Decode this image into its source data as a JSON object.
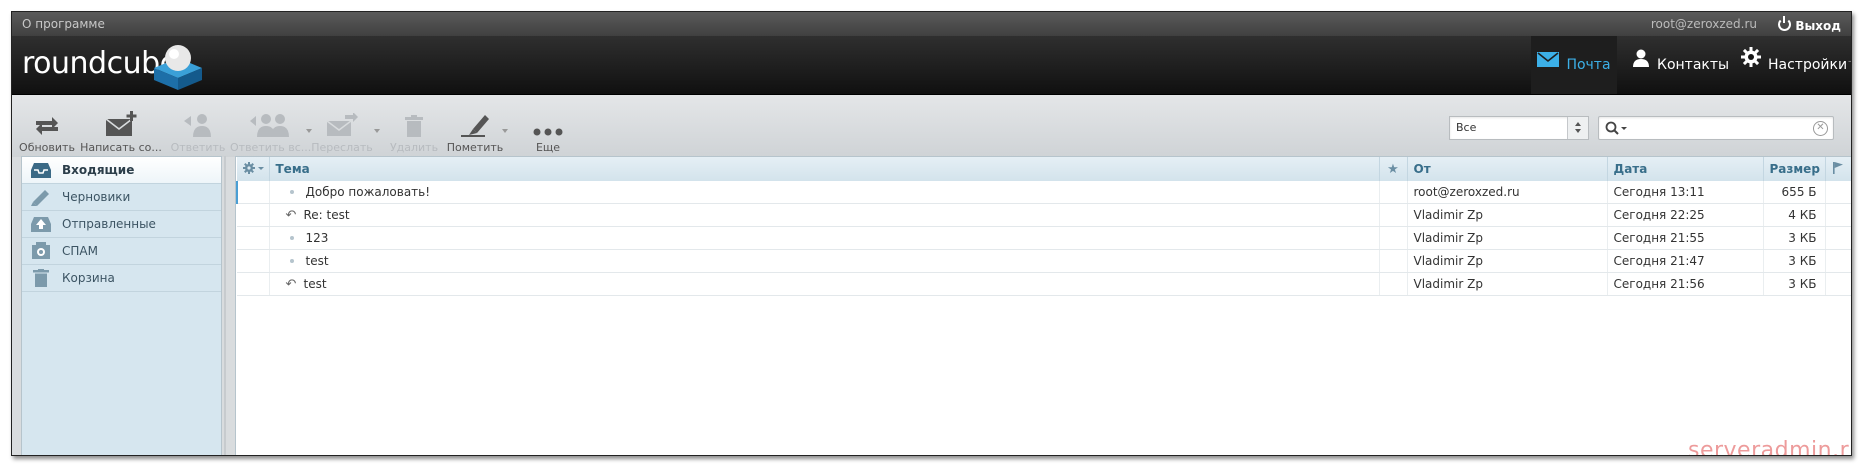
{
  "topbar": {
    "about": "О программе",
    "user": "root@zeroxzed.ru",
    "logout": "Выход"
  },
  "logo": "roundcube",
  "nav": {
    "mail": "Почта",
    "contacts": "Контакты",
    "settings": "Настройки"
  },
  "toolbar": {
    "refresh": "Обновить",
    "compose": "Написать со...",
    "reply": "Ответить",
    "reply_all": "Ответить вс...",
    "forward": "Переслать",
    "delete": "Удалить",
    "mark": "Пометить",
    "more": "Еще"
  },
  "filter": {
    "value": "Все"
  },
  "search": {
    "value": ""
  },
  "folders": [
    {
      "name": "Входящие",
      "icon": "inbox-icon"
    },
    {
      "name": "Черновики",
      "icon": "pencil-icon"
    },
    {
      "name": "Отправленные",
      "icon": "sent-icon"
    },
    {
      "name": "СПАМ",
      "icon": "spam-icon"
    },
    {
      "name": "Корзина",
      "icon": "trash-icon"
    }
  ],
  "columns": {
    "subject": "Тема",
    "from": "От",
    "date": "Дата",
    "size": "Размер"
  },
  "messages": [
    {
      "subject": "Добро пожаловать!",
      "from": "root@zeroxzed.ru",
      "date": "Сегодня 13:11",
      "size": "655 Б",
      "replied": false
    },
    {
      "subject": "Re: test",
      "from": "Vladimir Zp",
      "date": "Сегодня 22:25",
      "size": "4 КБ",
      "replied": true
    },
    {
      "subject": "123",
      "from": "Vladimir Zp",
      "date": "Сегодня 21:55",
      "size": "3 КБ",
      "replied": false
    },
    {
      "subject": "test",
      "from": "Vladimir Zp",
      "date": "Сегодня 21:47",
      "size": "3 КБ",
      "replied": false
    },
    {
      "subject": "test",
      "from": "Vladimir Zp",
      "date": "Сегодня 21:56",
      "size": "3 КБ",
      "replied": true
    }
  ],
  "watermark": "serveradmin.ru",
  "colors": {
    "accent": "#3cb0e8",
    "header": "#1a1a1a",
    "folder_bg": "#d6e6ef"
  }
}
